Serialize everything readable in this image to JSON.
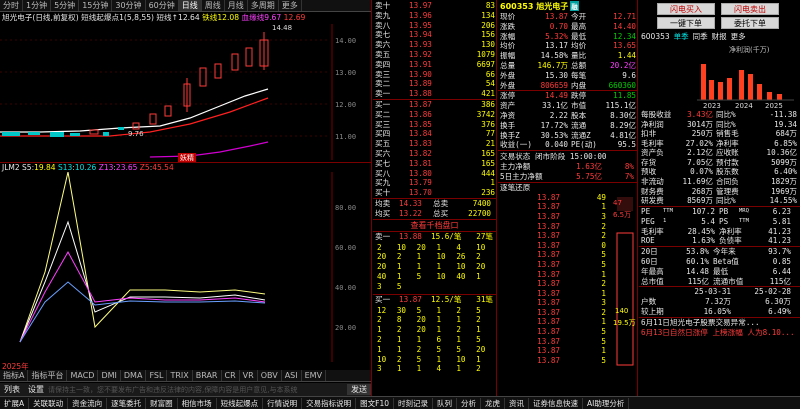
{
  "toolbar": {
    "items": [
      "分时",
      "1分钟",
      "5分钟",
      "15分钟",
      "30分钟",
      "60分钟",
      "日线",
      "周线",
      "月线",
      "多周期",
      "更多"
    ],
    "active_index": 6
  },
  "chart": {
    "title": "旭光电子(日线,前复权)",
    "indicator": "短线起爆点1(5,8,55)",
    "up_label": "短线↑",
    "up_value": "12.64",
    "sell_label": "铁线",
    "sell_value": "12.08",
    "neck_label": "血缘线",
    "neck_value": "9.67",
    "extra_value": "12.69",
    "high_label": "14.48",
    "low_label": "9.76",
    "signal": "妖精"
  },
  "price_axis": [
    "14.00",
    "13.00",
    "12.00",
    "11.00",
    "10.00"
  ],
  "jlm": {
    "title": "JLM2",
    "s5_label": "S5",
    "s5": "19.84",
    "s13_label": "S13",
    "s13": "10.26",
    "z13_label": "Z13",
    "z13": "23.65",
    "z5_label": "Z5",
    "z5": "45.54",
    "axis": [
      "80.00",
      "60.00",
      "40.00",
      "20.00"
    ]
  },
  "year_label": "2025年",
  "indicator_tabs": [
    "指标A",
    "指标平台",
    "MACD",
    "DMI",
    "DMA",
    "FSL",
    "TRIX",
    "BRAR",
    "CR",
    "VR",
    "OBV",
    "ASI",
    "EMV"
  ],
  "bottom_bar": {
    "list": "列表",
    "settings": "设置",
    "notice": "请保持主一致，您不要发布广告和违反法律的内容,保障内容是用户意见,与本系统",
    "send": "发送"
  },
  "status_bar": [
    "扩展A",
    "关联联动",
    "资金流向",
    "逐笔委托",
    "财富圈",
    "相信市场",
    "短线起爆点",
    "行情说明",
    "交易指标说明",
    "图文F10",
    "时刻记录",
    "队列",
    "分析",
    "龙虎",
    "资讯",
    "证券信息快速",
    "AI助理分析"
  ],
  "asks": [
    {
      "l": "卖十",
      "p": "13.97",
      "v": "83"
    },
    {
      "l": "卖九",
      "p": "13.96",
      "v": "134"
    },
    {
      "l": "卖八",
      "p": "13.95",
      "v": "206"
    },
    {
      "l": "卖七",
      "p": "13.94",
      "v": "156"
    },
    {
      "l": "卖六",
      "p": "13.93",
      "v": "130"
    },
    {
      "l": "卖五",
      "p": "13.92",
      "v": "1079"
    },
    {
      "l": "卖四",
      "p": "13.91",
      "v": "6697"
    },
    {
      "l": "卖三",
      "p": "13.90",
      "v": "66"
    },
    {
      "l": "卖二",
      "p": "13.89",
      "v": "54"
    },
    {
      "l": "卖一",
      "p": "13.88",
      "v": "421"
    }
  ],
  "bids": [
    {
      "l": "买一",
      "p": "13.87",
      "v": "386"
    },
    {
      "l": "买二",
      "p": "13.86",
      "v": "3742"
    },
    {
      "l": "买三",
      "p": "13.85",
      "v": "376"
    },
    {
      "l": "买四",
      "p": "13.84",
      "v": "77"
    },
    {
      "l": "买五",
      "p": "13.83",
      "v": "21"
    },
    {
      "l": "买六",
      "p": "13.82",
      "v": "165"
    },
    {
      "l": "买七",
      "p": "13.81",
      "v": "165"
    },
    {
      "l": "买八",
      "p": "13.80",
      "v": "444"
    },
    {
      "l": "买九",
      "p": "13.79",
      "v": "1"
    },
    {
      "l": "买十",
      "p": "13.70",
      "v": "236"
    }
  ],
  "avg_rows": [
    {
      "l": "均卖",
      "p": "14.33",
      "k": "总卖",
      "v": "7400"
    },
    {
      "l": "均买",
      "p": "13.22",
      "k": "总买",
      "v": "22700"
    }
  ],
  "stock": {
    "code": "600353",
    "name": "旭光电子",
    "badge": "融"
  },
  "quote": [
    {
      "k1": "现价",
      "v1": "13.87",
      "k2": "今开",
      "v2": "12.71",
      "c1": "r",
      "c2": "r"
    },
    {
      "k1": "涨跌",
      "v1": "0.70",
      "k2": "最高",
      "v2": "14.40",
      "c1": "r",
      "c2": "r"
    },
    {
      "k1": "涨幅",
      "v1": "5.32%",
      "k2": "最低",
      "v2": "12.34",
      "c1": "r",
      "c2": "g"
    },
    {
      "k1": "均价",
      "v1": "13.17",
      "k2": "均价",
      "v2": "13.65",
      "c1": "w",
      "c2": "r"
    },
    {
      "k1": "振幅",
      "v1": "14.58%",
      "k2": "量比",
      "v2": "1.44",
      "c1": "w",
      "c2": "y"
    },
    {
      "k1": "总量",
      "v1": "146.7万",
      "k2": "总额",
      "v2": "20.2亿",
      "c1": "y",
      "c2": "m"
    },
    {
      "k1": "外盘",
      "v1": "15.30",
      "k2": "每笔",
      "v2": "9.6",
      "c1": "w",
      "c2": "w"
    },
    {
      "k1": "外盘",
      "v1": "806659",
      "k2": "内盘",
      "v2": "660360",
      "c1": "r",
      "c2": "g"
    },
    {
      "k1": "涨停",
      "v1": "14.49",
      "k2": "跌停",
      "v2": "11.85",
      "c1": "r",
      "c2": "g"
    },
    {
      "k1": "资产",
      "v1": "33.1亿",
      "k2": "市值",
      "v2": "115.1亿",
      "c1": "w",
      "c2": "w"
    },
    {
      "k1": "净资",
      "v1": "2.22",
      "k2": "股本",
      "v2": "8.30亿",
      "c1": "w",
      "c2": "w"
    },
    {
      "k1": "换手",
      "v1": "17.72%",
      "k2": "流通",
      "v2": "8.29亿",
      "c1": "w",
      "c2": "w"
    },
    {
      "k1": "换手Z",
      "v1": "30.53%",
      "k2": "流通Z",
      "v2": "4.81亿",
      "c1": "w",
      "c2": "w"
    },
    {
      "k1": "收益(一)",
      "v1": "0.040",
      "k2": "PE(动)",
      "v2": "95.5",
      "c1": "w",
      "c2": "w"
    }
  ],
  "trade_state": {
    "label": "交易状态",
    "value": "闭市阶段 15:00:00"
  },
  "main_flow": [
    {
      "k": "主力净额",
      "v": "1.63亿",
      "p": "8%"
    },
    {
      "k": "5日主力净额",
      "v": "5.75亿",
      "p": "7%"
    }
  ],
  "tick_title": "逐笔还原",
  "ticks": [
    {
      "t": "",
      "p": "13.87",
      "v": "49"
    },
    {
      "t": "",
      "p": "13.87",
      "v": "1"
    },
    {
      "t": "",
      "p": "13.87",
      "v": "3"
    },
    {
      "t": "",
      "p": "13.87",
      "v": "2"
    },
    {
      "t": "",
      "p": "13.87",
      "v": "2"
    },
    {
      "t": "",
      "p": "13.87",
      "v": "0"
    },
    {
      "t": "",
      "p": "13.87",
      "v": "5"
    },
    {
      "t": "",
      "p": "13.87",
      "v": "5"
    },
    {
      "t": "",
      "p": "13.87",
      "v": "1"
    },
    {
      "t": "",
      "p": "13.87",
      "v": "2"
    },
    {
      "t": "",
      "p": "13.87",
      "v": "1"
    },
    {
      "t": "",
      "p": "13.87",
      "v": "3"
    },
    {
      "t": "",
      "p": "13.87",
      "v": "2"
    },
    {
      "t": "",
      "p": "13.87",
      "v": "1"
    },
    {
      "t": "",
      "p": "13.87",
      "v": "5"
    },
    {
      "t": "",
      "p": "13.87",
      "v": "5"
    },
    {
      "t": "",
      "p": "13.87",
      "v": "1"
    },
    {
      "t": "",
      "p": "13.87",
      "v": "5"
    }
  ],
  "depth_btn": "查看千档盘口",
  "depth_sell": {
    "label": "卖一",
    "p": "13.88",
    "n": "15.6/笔",
    "c": "27笔"
  },
  "depth_buy": {
    "label": "买一",
    "p": "13.87",
    "n": "12.5/笔",
    "c": "31笔"
  },
  "queue_sell": [
    [
      "2",
      "10",
      "20",
      "1",
      "4",
      "10"
    ],
    [
      "20",
      "2",
      "1",
      "10",
      "26",
      "2"
    ],
    [
      "20",
      "1",
      "1",
      "1",
      "10",
      "20"
    ],
    [
      "40",
      "1",
      "5",
      "10",
      "40",
      "1"
    ],
    [
      "3",
      "5",
      "",
      "",
      "",
      ""
    ]
  ],
  "queue_buy": [
    [
      "12",
      "30",
      "5",
      "1",
      "2",
      "5"
    ],
    [
      "2",
      "8",
      "20",
      "1",
      "1",
      "2"
    ],
    [
      "1",
      "2",
      "20",
      "1",
      "2",
      "1"
    ],
    [
      "2",
      "1",
      "1",
      "6",
      "1",
      "5"
    ],
    [
      "1",
      "1",
      "2",
      "5",
      "5",
      "20"
    ],
    [
      "10",
      "2",
      "5",
      "1",
      "10",
      "1"
    ],
    [
      "3",
      "1",
      "1",
      "4",
      "1",
      "2"
    ]
  ],
  "bar_labels": {
    "a": "47",
    "b": "6.5万",
    "c": "140",
    "d": "19.5万"
  },
  "right": {
    "flash_buy": "闪电买入",
    "flash_sell": "闪电卖出",
    "order_buy": "一键下单",
    "order_sell": "委托下单",
    "code": "600353",
    "tabs": [
      "单季",
      "同季",
      "财报",
      "更多"
    ],
    "chart_title": "净利润(千万)",
    "years": [
      "2023",
      "2024",
      "2025"
    ]
  },
  "fin": [
    {
      "k": "每股收益",
      "v": "3.43亿",
      "k2": "同比%",
      "v2": "-11.38",
      "c": "r"
    },
    {
      "k": "净利润",
      "v": "3014万",
      "k2": "同比%",
      "v2": "19.34",
      "c": "w"
    },
    {
      "k": "扣非",
      "v": "250万",
      "k2": "销售毛",
      "v2": "684万",
      "c": "w"
    },
    {
      "k": "毛利率",
      "v": "27.02%",
      "k2": "净利率",
      "v2": "6.85%",
      "c": "w"
    },
    {
      "k": "资产负",
      "v": "2.12亿",
      "k2": "应收账",
      "v2": "10.36亿",
      "c": "w"
    },
    {
      "k": "存货",
      "v": "7.05亿",
      "k2": "预付款",
      "v2": "5099万",
      "c": "w"
    },
    {
      "k": "预收",
      "v": "0.07%",
      "k2": "股东数",
      "v2": "6.40%",
      "c": "w"
    },
    {
      "k": "非流动",
      "v": "11.69亿",
      "k2": "合同负",
      "v2": "1829万",
      "c": "w"
    },
    {
      "k": "财务费",
      "v": "268万",
      "k2": "管理费",
      "v2": "1969万",
      "c": "w"
    },
    {
      "k": "研发费",
      "v": "8569万",
      "k2": "同比%",
      "v2": "14.55%",
      "c": "w"
    }
  ],
  "metrics": [
    {
      "k": "PE",
      "s": "TTM",
      "v": "107.2",
      "k2": "PB",
      "s2": "MRQ",
      "v2": "6.23"
    },
    {
      "k": "PEG",
      "s": "1",
      "v": "5.4",
      "k2": "PS",
      "s2": "TTM",
      "v2": "5.81"
    },
    {
      "k": "毛利率",
      "s": "",
      "v": "28.45%",
      "k2": "净利率",
      "s2": "",
      "v2": "41.23"
    },
    {
      "k": "ROE",
      "s": "",
      "v": "1.63%",
      "k2": "负债率",
      "s2": "",
      "v2": "41.23"
    }
  ],
  "stats": [
    {
      "k": "20日",
      "v": "53.8%",
      "k2": "今年来",
      "v2": "93.7%"
    },
    {
      "k": "60日",
      "v": "60.1%",
      "k2": "Beta值",
      "v2": "0.85"
    },
    {
      "k": "年最高",
      "v": "14.48",
      "k2": "最低",
      "v2": "6.44"
    },
    {
      "k": "总市值",
      "v": "115亿",
      "k2": "流通市值",
      "v2": "115亿"
    }
  ],
  "holder": {
    "hdr": [
      "",
      "25-03-31",
      "25-02-28"
    ],
    "rows": [
      {
        "k": "户数",
        "v": "7.32万",
        "v2": "6.30万"
      },
      {
        "k": "较上期",
        "v": "16.05%",
        "v2": "6.49%"
      }
    ]
  },
  "news": [
    "6月11日旭光电子股票交易异常...",
    "6月13日自然日涨停 上榜涨幅 人为8.10..."
  ]
}
